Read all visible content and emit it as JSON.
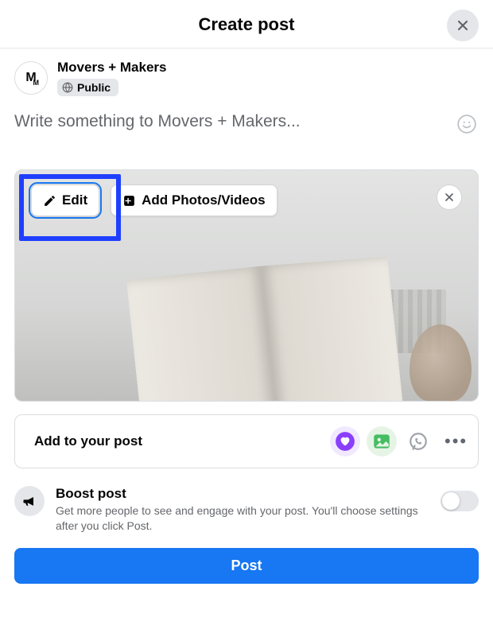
{
  "header": {
    "title": "Create post"
  },
  "author": {
    "avatar_initials": "M",
    "avatar_sub": "M",
    "name": "Movers + Makers",
    "privacy_label": "Public"
  },
  "compose": {
    "placeholder": "Write something to Movers + Makers..."
  },
  "media": {
    "edit_label": "Edit",
    "add_label": "Add Photos/Videos"
  },
  "add_bar": {
    "label": "Add to your post"
  },
  "boost": {
    "title": "Boost post",
    "desc": "Get more people to see and engage with your post. You'll choose settings after you click Post."
  },
  "post_button": "Post",
  "colors": {
    "accent": "#1877f2",
    "highlight": "#1f3fff"
  }
}
